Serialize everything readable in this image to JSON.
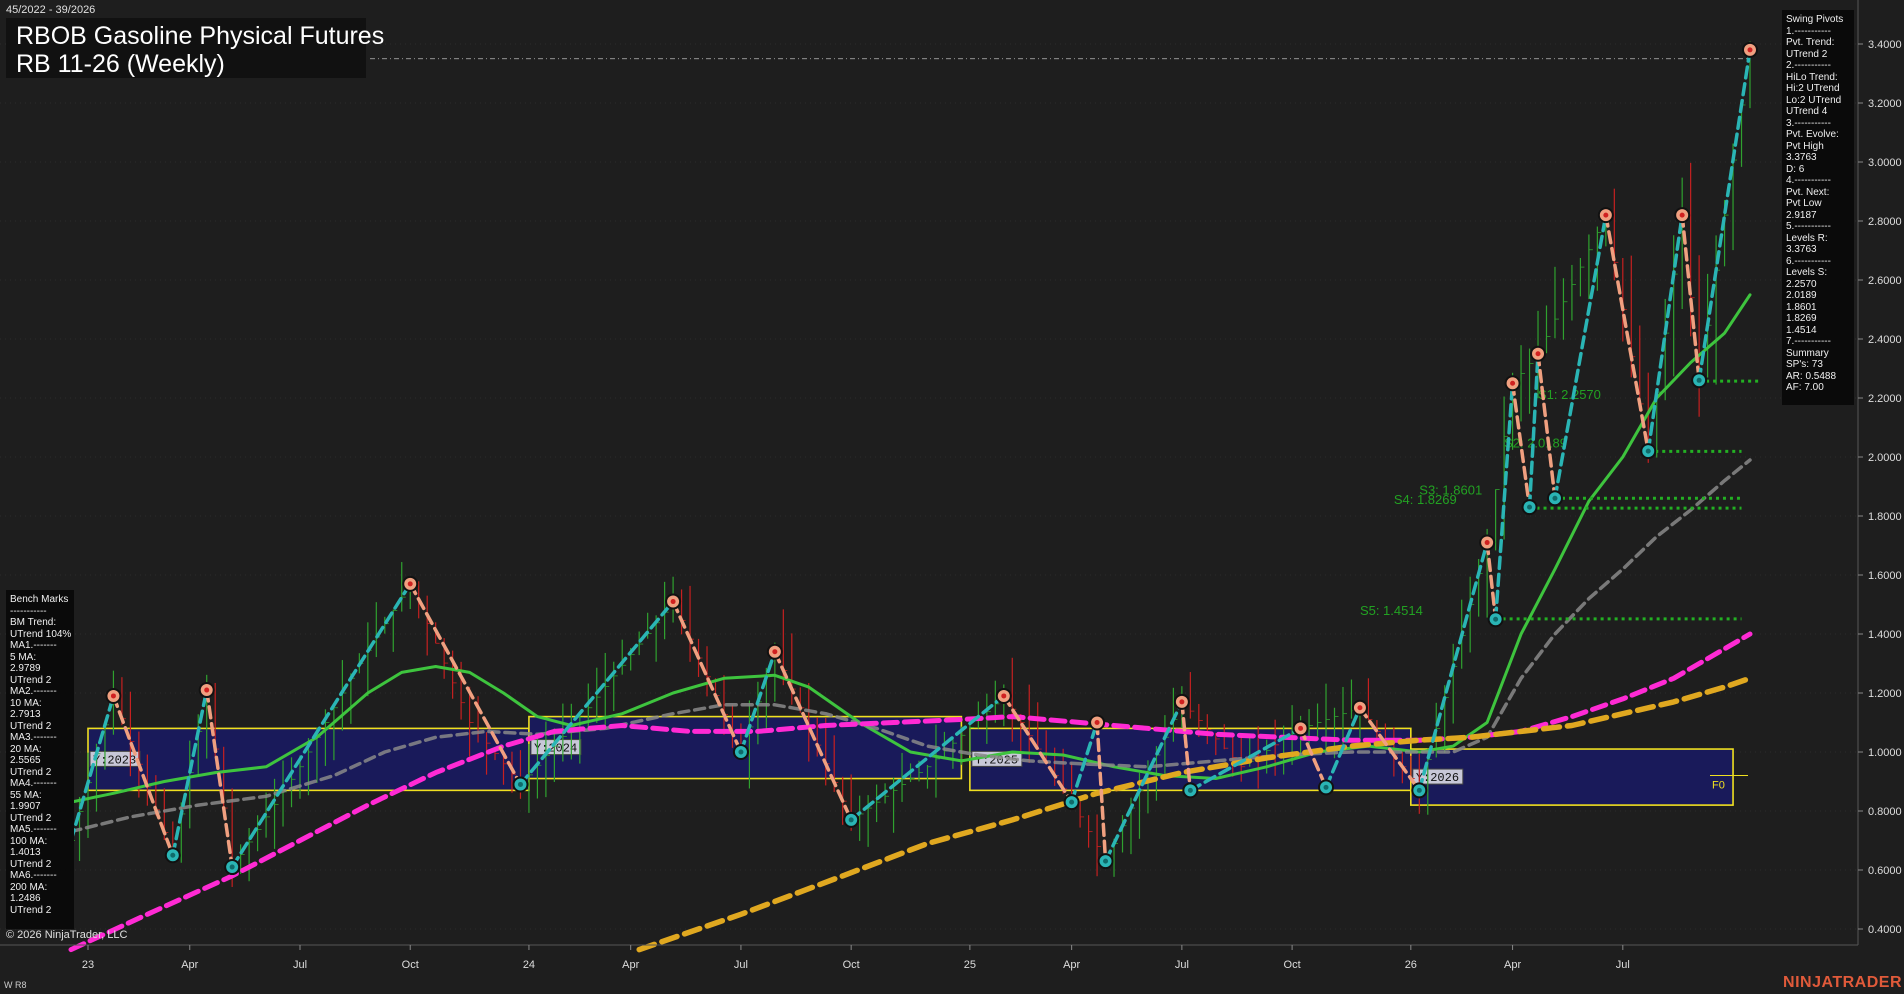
{
  "header": {
    "date_range": "45/2022 - 39/2026",
    "title": "RBOB Gasoline Physical Futures",
    "subtitle": "RB 11-26 (Weekly)"
  },
  "swing_pivots_panel": {
    "lines": [
      "Swing Pivots",
      "1.-----------",
      "Pvt. Trend:",
      "UTrend 2",
      "2.-----------",
      "HiLo Trend:",
      "Hi:2 UTrend",
      "Lo:2 UTrend",
      "UTrend 4",
      "3.-----------",
      "Pvt. Evolve:",
      "Pvt High",
      "3.3763",
      "D: 6",
      "4.-----------",
      "Pvt. Next:",
      "Pvt Low",
      "2.9187",
      "5.-----------",
      "Levels R:",
      "3.3763",
      "6.-----------",
      "Levels S:",
      "2.2570",
      "2.0189",
      "1.8601",
      "1.8269",
      "1.4514",
      "7.-----------",
      "Summary",
      "SP's: 73",
      "AR: 0.5488",
      "AF: 7.00"
    ]
  },
  "bench_marks_panel": {
    "lines": [
      "Bench Marks",
      "-----------",
      "BM Trend:",
      "UTrend 104%",
      "MA1.-------",
      "5 MA:",
      "2.9789",
      "UTrend 2",
      "MA2.-------",
      "10 MA:",
      "2.7913",
      "UTrend 2",
      "MA3.-------",
      "20 MA:",
      "2.5565",
      "UTrend 2",
      "MA4.-------",
      "55 MA:",
      "1.9907",
      "UTrend 2",
      "MA5.-------",
      "100 MA:",
      "1.4013",
      "UTrend 2",
      "MA6.-------",
      "200 MA:",
      "1.2486",
      "UTrend 2"
    ]
  },
  "copyright": "© 2026 NinjaTrader, LLC",
  "footer_left": "W R8",
  "brand": "NINJATRADER",
  "colors": {
    "background": "#1e1e1e",
    "grid": "#3a3a3a",
    "up_bar": "#2fa12f",
    "down_bar": "#c62020",
    "swing_up": "#2ab5b5",
    "swing_down": "#f0a080",
    "ma20": "#3ec43e",
    "ma55": "#8a8a8a",
    "ma100": "#ff2ad4",
    "ma200": "#e0a820",
    "support": "#23b023",
    "year_box_fill": "#191a5a",
    "year_box_stroke": "#f0e020"
  },
  "chart_data": {
    "type": "line",
    "title": "RBOB Gasoline Physical Futures",
    "timeframe": "Weekly",
    "y_axis": {
      "position": "right",
      "ylim": [
        0.34,
        3.5
      ],
      "ticks": [
        "0.4000",
        "0.6000",
        "0.8000",
        "1.0000",
        "1.2000",
        "1.4000",
        "1.6000",
        "1.8000",
        "2.0000",
        "2.2000",
        "2.4000",
        "2.6000",
        "2.8000",
        "3.0000",
        "3.2000",
        "3.4000"
      ],
      "tick_values": [
        0.4,
        0.6,
        0.8,
        1.0,
        1.2,
        1.4,
        1.6,
        1.8,
        2.0,
        2.2,
        2.4,
        2.6,
        2.8,
        3.0,
        3.2,
        3.4
      ]
    },
    "x_axis": {
      "range_weeks": [
        0,
        196
      ],
      "ticks": [
        {
          "w": 1,
          "label": "23"
        },
        {
          "w": 13,
          "label": "Apr"
        },
        {
          "w": 26,
          "label": "Jul"
        },
        {
          "w": 39,
          "label": "Oct"
        },
        {
          "w": 53,
          "label": "24"
        },
        {
          "w": 65,
          "label": "Apr"
        },
        {
          "w": 78,
          "label": "Jul"
        },
        {
          "w": 91,
          "label": "Oct"
        },
        {
          "w": 105,
          "label": "25"
        },
        {
          "w": 117,
          "label": "Apr"
        },
        {
          "w": 130,
          "label": "Jul"
        },
        {
          "w": 143,
          "label": "Oct"
        },
        {
          "w": 157,
          "label": "26"
        },
        {
          "w": 169,
          "label": "Apr"
        },
        {
          "w": 182,
          "label": "Jul"
        }
      ]
    },
    "current_price_line": 3.35,
    "swing_pivots": [
      {
        "w": -1,
        "y": 0.7,
        "t": "L"
      },
      {
        "w": 4,
        "y": 1.19,
        "t": "H"
      },
      {
        "w": 11,
        "y": 0.65,
        "t": "L"
      },
      {
        "w": 15,
        "y": 1.21,
        "t": "H"
      },
      {
        "w": 18,
        "y": 0.61,
        "t": "L"
      },
      {
        "w": 39,
        "y": 1.57,
        "t": "H"
      },
      {
        "w": 52,
        "y": 0.89,
        "t": "L"
      },
      {
        "w": 70,
        "y": 1.51,
        "t": "H"
      },
      {
        "w": 78,
        "y": 1.0,
        "t": "L"
      },
      {
        "w": 82,
        "y": 1.34,
        "t": "H"
      },
      {
        "w": 91,
        "y": 0.77,
        "t": "L"
      },
      {
        "w": 109,
        "y": 1.19,
        "t": "H"
      },
      {
        "w": 117,
        "y": 0.83,
        "t": "L"
      },
      {
        "w": 120,
        "y": 1.1,
        "t": "H"
      },
      {
        "w": 121,
        "y": 0.63,
        "t": "L"
      },
      {
        "w": 130,
        "y": 1.17,
        "t": "H"
      },
      {
        "w": 131,
        "y": 0.87,
        "t": "L"
      },
      {
        "w": 144,
        "y": 1.08,
        "t": "H"
      },
      {
        "w": 147,
        "y": 0.88,
        "t": "L"
      },
      {
        "w": 151,
        "y": 1.15,
        "t": "H"
      },
      {
        "w": 158,
        "y": 0.87,
        "t": "L"
      },
      {
        "w": 166,
        "y": 1.71,
        "t": "H"
      },
      {
        "w": 167,
        "y": 1.45,
        "t": "L"
      },
      {
        "w": 169,
        "y": 2.25,
        "t": "H"
      },
      {
        "w": 171,
        "y": 1.83,
        "t": "L"
      },
      {
        "w": 172,
        "y": 2.35,
        "t": "H"
      },
      {
        "w": 174,
        "y": 1.86,
        "t": "L"
      },
      {
        "w": 180,
        "y": 2.82,
        "t": "H"
      },
      {
        "w": 185,
        "y": 2.02,
        "t": "L"
      },
      {
        "w": 189,
        "y": 2.82,
        "t": "H"
      },
      {
        "w": 191,
        "y": 2.26,
        "t": "L"
      },
      {
        "w": 197,
        "y": 3.38,
        "t": "H"
      }
    ],
    "moving_averages": [
      {
        "name": "20 MA",
        "key": "ma20",
        "value": 2.5565,
        "points": [
          [
            -1,
            0.83
          ],
          [
            4,
            0.86
          ],
          [
            10,
            0.9
          ],
          [
            16,
            0.93
          ],
          [
            22,
            0.95
          ],
          [
            28,
            1.05
          ],
          [
            34,
            1.2
          ],
          [
            38,
            1.27
          ],
          [
            42,
            1.29
          ],
          [
            46,
            1.27
          ],
          [
            50,
            1.2
          ],
          [
            54,
            1.12
          ],
          [
            58,
            1.09
          ],
          [
            64,
            1.13
          ],
          [
            70,
            1.2
          ],
          [
            76,
            1.25
          ],
          [
            82,
            1.26
          ],
          [
            86,
            1.22
          ],
          [
            92,
            1.1
          ],
          [
            98,
            1.0
          ],
          [
            104,
            0.97
          ],
          [
            110,
            1.0
          ],
          [
            116,
            0.99
          ],
          [
            122,
            0.95
          ],
          [
            128,
            0.92
          ],
          [
            134,
            0.91
          ],
          [
            140,
            0.95
          ],
          [
            146,
            1.0
          ],
          [
            152,
            1.02
          ],
          [
            158,
            1.0
          ],
          [
            162,
            1.02
          ],
          [
            166,
            1.1
          ],
          [
            170,
            1.4
          ],
          [
            174,
            1.62
          ],
          [
            178,
            1.85
          ],
          [
            182,
            2.0
          ],
          [
            186,
            2.2
          ],
          [
            190,
            2.32
          ],
          [
            194,
            2.42
          ],
          [
            197,
            2.55
          ]
        ]
      },
      {
        "name": "55 MA",
        "key": "ma55",
        "value": 1.9907,
        "dashed": true,
        "points": [
          [
            -1,
            0.73
          ],
          [
            6,
            0.78
          ],
          [
            14,
            0.82
          ],
          [
            22,
            0.85
          ],
          [
            30,
            0.92
          ],
          [
            36,
            1.0
          ],
          [
            42,
            1.05
          ],
          [
            48,
            1.07
          ],
          [
            54,
            1.06
          ],
          [
            62,
            1.08
          ],
          [
            70,
            1.13
          ],
          [
            76,
            1.16
          ],
          [
            82,
            1.16
          ],
          [
            88,
            1.13
          ],
          [
            94,
            1.08
          ],
          [
            100,
            1.02
          ],
          [
            106,
            0.99
          ],
          [
            112,
            0.97
          ],
          [
            118,
            0.96
          ],
          [
            126,
            0.95
          ],
          [
            134,
            0.97
          ],
          [
            142,
            0.99
          ],
          [
            150,
            1.0
          ],
          [
            156,
            1.0
          ],
          [
            162,
            1.0
          ],
          [
            166,
            1.05
          ],
          [
            170,
            1.25
          ],
          [
            174,
            1.4
          ],
          [
            178,
            1.52
          ],
          [
            182,
            1.62
          ],
          [
            186,
            1.73
          ],
          [
            190,
            1.82
          ],
          [
            194,
            1.92
          ],
          [
            197,
            1.99
          ]
        ]
      },
      {
        "name": "100 MA",
        "key": "ma100",
        "value": 1.4013,
        "dashed": true,
        "points": [
          [
            -1,
            0.33
          ],
          [
            8,
            0.45
          ],
          [
            18,
            0.58
          ],
          [
            26,
            0.7
          ],
          [
            34,
            0.82
          ],
          [
            42,
            0.93
          ],
          [
            50,
            1.02
          ],
          [
            56,
            1.07
          ],
          [
            64,
            1.09
          ],
          [
            72,
            1.07
          ],
          [
            80,
            1.07
          ],
          [
            88,
            1.09
          ],
          [
            96,
            1.1
          ],
          [
            104,
            1.11
          ],
          [
            110,
            1.12
          ],
          [
            118,
            1.1
          ],
          [
            126,
            1.08
          ],
          [
            134,
            1.06
          ],
          [
            142,
            1.05
          ],
          [
            150,
            1.04
          ],
          [
            158,
            1.04
          ],
          [
            164,
            1.05
          ],
          [
            170,
            1.07
          ],
          [
            176,
            1.12
          ],
          [
            182,
            1.18
          ],
          [
            188,
            1.25
          ],
          [
            194,
            1.35
          ],
          [
            197,
            1.4
          ]
        ]
      },
      {
        "name": "200 MA",
        "key": "ma200",
        "value": 1.2486,
        "dashed": true,
        "points": [
          [
            66,
            0.33
          ],
          [
            78,
            0.45
          ],
          [
            90,
            0.58
          ],
          [
            100,
            0.69
          ],
          [
            110,
            0.77
          ],
          [
            120,
            0.86
          ],
          [
            130,
            0.93
          ],
          [
            140,
            0.98
          ],
          [
            150,
            1.02
          ],
          [
            158,
            1.04
          ],
          [
            164,
            1.05
          ],
          [
            170,
            1.07
          ],
          [
            176,
            1.09
          ],
          [
            182,
            1.13
          ],
          [
            188,
            1.17
          ],
          [
            194,
            1.22
          ],
          [
            197,
            1.25
          ]
        ]
      }
    ],
    "support_levels": [
      {
        "label": "S1: 2.2570",
        "value": 2.257,
        "w0": 191,
        "w1": 198,
        "lx": 172
      },
      {
        "label": "S2: 2.0189",
        "value": 2.0189,
        "w0": 185,
        "w1": 196,
        "lx": 168
      },
      {
        "label": "S3: 1.8601",
        "value": 1.8601,
        "w0": 174,
        "w1": 196,
        "lx": 158
      },
      {
        "label": "S4: 1.8269",
        "value": 1.8269,
        "w0": 171,
        "w1": 196,
        "lx": 155
      },
      {
        "label": "S5: 1.4514",
        "value": 1.4514,
        "w0": 167,
        "w1": 196,
        "lx": 151
      }
    ],
    "year_boxes": [
      {
        "label": "Y:2023",
        "w0": 1,
        "w1": 53,
        "lo": 0.87,
        "hi": 1.08
      },
      {
        "label": "Y:2024",
        "w0": 53,
        "w1": 104,
        "lo": 0.91,
        "hi": 1.12
      },
      {
        "label": "Y:2025",
        "w0": 105,
        "w1": 157,
        "lo": 0.87,
        "hi": 1.08
      },
      {
        "label": "Y:2026",
        "w0": 157,
        "w1": 195,
        "lo": 0.82,
        "hi": 1.01
      }
    ],
    "f0_marker": {
      "label": "F0",
      "value": 0.91
    },
    "price_range_by_period": [
      [
        -1,
        0.7
      ],
      [
        4,
        1.19
      ],
      [
        11,
        0.65
      ],
      [
        15,
        1.21
      ],
      [
        18,
        0.61
      ],
      [
        26,
        0.95
      ],
      [
        33,
        1.3
      ],
      [
        39,
        1.57
      ],
      [
        46,
        1.1
      ],
      [
        52,
        0.89
      ],
      [
        60,
        1.15
      ],
      [
        70,
        1.51
      ],
      [
        78,
        1.0
      ],
      [
        82,
        1.34
      ],
      [
        91,
        0.77
      ],
      [
        100,
        0.95
      ],
      [
        109,
        1.19
      ],
      [
        117,
        0.83
      ],
      [
        121,
        0.63
      ],
      [
        130,
        1.17
      ],
      [
        137,
        0.95
      ],
      [
        144,
        1.08
      ],
      [
        151,
        1.15
      ],
      [
        158,
        0.87
      ],
      [
        166,
        1.71
      ],
      [
        169,
        2.25
      ],
      [
        172,
        2.35
      ],
      [
        180,
        2.82
      ],
      [
        185,
        2.02
      ],
      [
        189,
        2.82
      ],
      [
        191,
        2.26
      ],
      [
        197,
        3.38
      ]
    ]
  }
}
